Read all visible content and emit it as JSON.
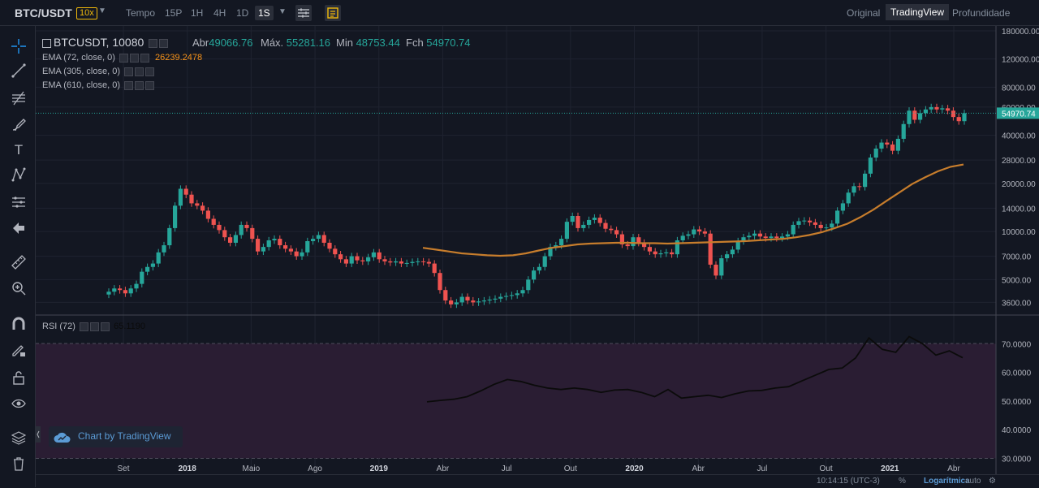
{
  "topbar": {
    "pair": "BTC/USDT",
    "leverage": "10x",
    "tempo_label": "Tempo",
    "intervals": [
      "15P",
      "1H",
      "4H",
      "1D",
      "1S"
    ],
    "active_interval": "1S",
    "views": [
      "Original",
      "TradingView",
      "Profundidade"
    ],
    "active_view": "TradingView"
  },
  "legend": {
    "symbol": "BTCUSDT, 10080",
    "open_label": "Abr",
    "open": "49066.76",
    "high_label": "Máx.",
    "high": "55281.16",
    "low_label": "Min",
    "low": "48753.44",
    "close_label": "Fch",
    "close": "54970.74",
    "ema72": "EMA (72, close, 0)",
    "ema72_value": "26239.2478",
    "ema305": "EMA (305, close, 0)",
    "ema610": "EMA (610, close, 0)",
    "rsi": "RSI (72)",
    "rsi_value": "65.1190"
  },
  "price_axis": [
    "180000.00",
    "120000.00",
    "80000.00",
    "60000.00",
    "54970.74",
    "40000.00",
    "28000.00",
    "20000.00",
    "14000.00",
    "10000.00",
    "7000.00",
    "5000.00",
    "3600.00"
  ],
  "rsi_axis": [
    "70.0000",
    "60.0000",
    "50.0000",
    "40.0000",
    "30.0000"
  ],
  "time_axis": [
    "Set",
    "2018",
    "Maio",
    "Ago",
    "2019",
    "Abr",
    "Jul",
    "Out",
    "2020",
    "Abr",
    "Jul",
    "Out",
    "2021",
    "Abr"
  ],
  "branding": "Chart by TradingView",
  "bottombar": {
    "clock": "10:14:15 (UTC-3)",
    "percent": "%",
    "log": "Logarítmica",
    "auto": "auto"
  },
  "colors": {
    "up": "#26a69a",
    "down": "#ef5350",
    "ema": "#c77d2c",
    "rsi_line": "#0b0b0b",
    "rsi_band": "#2a1d33",
    "accent": "#f0b90b"
  },
  "chart_data": {
    "type": "candlestick",
    "scale": "log",
    "price_ylim": [
      3000,
      180000
    ],
    "rsi_ylim": [
      25,
      80
    ],
    "rsi_bands": [
      30,
      70
    ],
    "last_price": 54970.74,
    "candles_close_path": [
      4200,
      4400,
      4300,
      4100,
      4400,
      4700,
      5600,
      6000,
      6300,
      7400,
      8200,
      10500,
      14500,
      18500,
      17000,
      15000,
      14500,
      13500,
      12000,
      11000,
      10200,
      9200,
      8500,
      9500,
      11000,
      10500,
      9000,
      7500,
      8000,
      8800,
      9000,
      8200,
      7800,
      7500,
      7000,
      7400,
      8700,
      9000,
      9500,
      8500,
      7800,
      7200,
      6700,
      6300,
      7000,
      6600,
      6500,
      6900,
      7400,
      6700,
      6500,
      6400,
      6500,
      6300,
      6350,
      6450,
      6500,
      6450,
      6300,
      5500,
      4300,
      3700,
      3500,
      3600,
      3900,
      3700,
      3600,
      3650,
      3700,
      3750,
      3800,
      3900,
      3950,
      4000,
      4100,
      4300,
      5000,
      5700,
      6000,
      7000,
      8000,
      8200,
      9000,
      11500,
      12500,
      10500,
      11000,
      11800,
      12200,
      11300,
      10400,
      10200,
      9600,
      8300,
      8100,
      9200,
      8500,
      8000,
      7500,
      7200,
      7300,
      7400,
      7200,
      8800,
      9400,
      9600,
      10300,
      10000,
      9700,
      6200,
      5300,
      6800,
      7200,
      7700,
      8700,
      9200,
      9400,
      9700,
      9300,
      9100,
      9300,
      9100,
      9300,
      9600,
      11000,
      11600,
      11700,
      11400,
      11000,
      10500,
      10600,
      11200,
      13500,
      15000,
      17500,
      19200,
      19000,
      23000,
      29000,
      33000,
      36000,
      35000,
      32000,
      38000,
      47000,
      57000,
      50000,
      55000,
      58000,
      60000,
      58000,
      59000,
      57000,
      52000,
      49000,
      55000
    ],
    "ema72": [
      7900,
      7700,
      7500,
      7300,
      7200,
      7100,
      7050,
      7100,
      7300,
      7600,
      7900,
      8100,
      8300,
      8400,
      8450,
      8500,
      8500,
      8450,
      8450,
      8400,
      8450,
      8500,
      8550,
      8600,
      8650,
      8700,
      8800,
      8900,
      9000,
      9200,
      9500,
      9900,
      10500,
      11200,
      12300,
      13700,
      15500,
      17500,
      19800,
      21800,
      23800,
      25400,
      26240
    ],
    "rsi72": [
      49.7,
      50.2,
      50.6,
      51.5,
      53.5,
      55.8,
      57.5,
      56.8,
      55.5,
      54.5,
      54.0,
      54.5,
      54.0,
      53.0,
      53.8,
      54.0,
      53.0,
      51.5,
      54.0,
      51.0,
      51.5,
      52.0,
      51.2,
      52.5,
      53.5,
      53.7,
      54.5,
      55.0,
      57.0,
      59.0,
      61.0,
      61.5,
      65.0,
      72.0,
      68.0,
      67.0,
      72.5,
      70.0,
      66.0,
      67.5,
      65.1
    ]
  }
}
